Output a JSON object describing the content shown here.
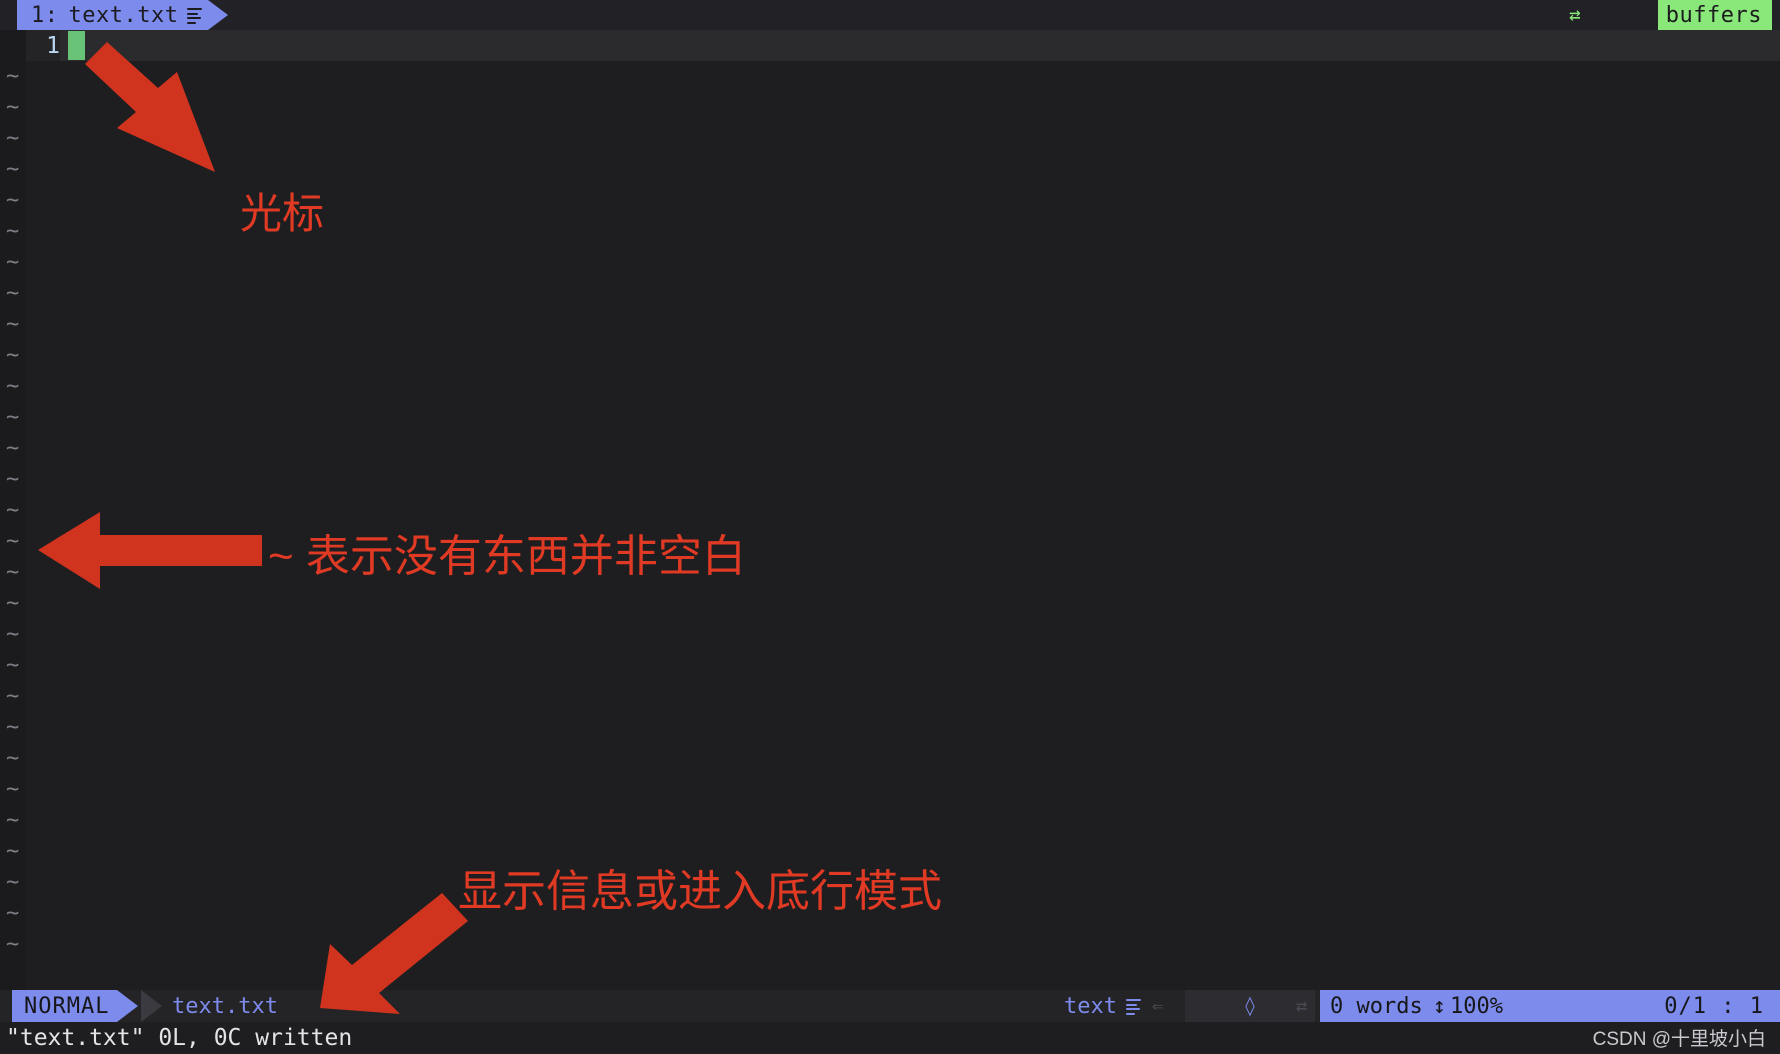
{
  "bufferline": {
    "tab": {
      "index": "1:",
      "filename": "text.txt",
      "modified_icon": "lines-icon"
    },
    "buffers_label": "buffers",
    "buffers_arrow_icon": "tab-arrow-icon",
    "tab_bg": "#7c8bec",
    "buffers_bg": "#8ae87b"
  },
  "editor": {
    "line_number": "1",
    "cursor_color": "#68c377",
    "empty_marker": "~",
    "empty_marker_count": 29
  },
  "statusline": {
    "mode": "NORMAL",
    "filename": "text.txt",
    "filetype": "text",
    "filetype_icon": "lines-icon",
    "sep_icon": "chevron-icon",
    "git_icon": "diamond-icon",
    "encoding_icon": "tab-arrow-icon",
    "words": "0 words",
    "scroll_icon": "updown-arrow-icon",
    "scroll_percent": "100%",
    "position": "0/1 :   1",
    "accent": "#7c8bec"
  },
  "cmdline": {
    "message": "\"text.txt\" 0L, 0C written"
  },
  "watermark": "CSDN @十里坡小白",
  "annotations": {
    "cursor": "光标",
    "tilde": "~ 表示没有东西并非空白",
    "cmdline": "显示信息或进入底行模式",
    "arrow_color": "#d0341f"
  }
}
